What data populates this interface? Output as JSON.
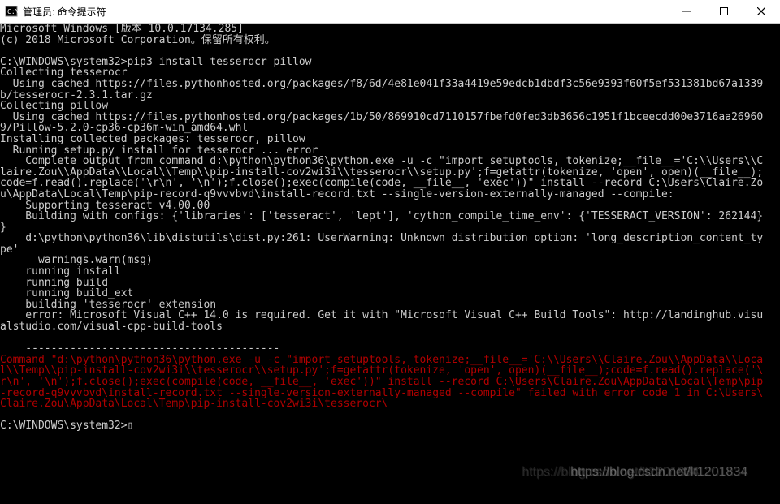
{
  "window": {
    "title": "管理员: 命令提示符",
    "icon": "cmd-icon"
  },
  "terminal": {
    "lines": [
      {
        "t": "Microsoft Windows [版本 10.0.17134.285]",
        "c": ""
      },
      {
        "t": "(c) 2018 Microsoft Corporation。保留所有权利。",
        "c": ""
      },
      {
        "t": "",
        "c": ""
      },
      {
        "t": "C:\\WINDOWS\\system32>pip3 install tesserocr pillow",
        "c": ""
      },
      {
        "t": "Collecting tesserocr",
        "c": ""
      },
      {
        "t": "  Using cached https://files.pythonhosted.org/packages/f8/6d/4e81e041f33a4419e59edcb1dbdf3c56e9393f60f5ef531381bd67a1339",
        "c": ""
      },
      {
        "t": "b/tesserocr-2.3.1.tar.gz",
        "c": ""
      },
      {
        "t": "Collecting pillow",
        "c": ""
      },
      {
        "t": "  Using cached https://files.pythonhosted.org/packages/1b/50/869910cd7110157fbefd0fed3db3656c1951f1bceecdd00e3716aa26960",
        "c": ""
      },
      {
        "t": "9/Pillow-5.2.0-cp36-cp36m-win_amd64.whl",
        "c": ""
      },
      {
        "t": "Installing collected packages: tesserocr, pillow",
        "c": ""
      },
      {
        "t": "  Running setup.py install for tesserocr ... error",
        "c": ""
      },
      {
        "t": "    Complete output from command d:\\python\\python36\\python.exe -u -c \"import setuptools, tokenize;__file__='C:\\\\Users\\\\C",
        "c": ""
      },
      {
        "t": "laire.Zou\\\\AppData\\\\Local\\\\Temp\\\\pip-install-cov2wi3i\\\\tesserocr\\\\setup.py';f=getattr(tokenize, 'open', open)(__file__);",
        "c": ""
      },
      {
        "t": "code=f.read().replace('\\r\\n', '\\n');f.close();exec(compile(code, __file__, 'exec'))\" install --record C:\\Users\\Claire.Zo",
        "c": ""
      },
      {
        "t": "u\\AppData\\Local\\Temp\\pip-record-q9vvvbvd\\install-record.txt --single-version-externally-managed --compile:",
        "c": ""
      },
      {
        "t": "    Supporting tesseract v4.00.00",
        "c": ""
      },
      {
        "t": "    Building with configs: {'libraries': ['tesseract', 'lept'], 'cython_compile_time_env': {'TESSERACT_VERSION': 262144}",
        "c": ""
      },
      {
        "t": "}",
        "c": ""
      },
      {
        "t": "    d:\\python\\python36\\lib\\distutils\\dist.py:261: UserWarning: Unknown distribution option: 'long_description_content_ty",
        "c": ""
      },
      {
        "t": "pe'",
        "c": ""
      },
      {
        "t": "      warnings.warn(msg)",
        "c": ""
      },
      {
        "t": "    running install",
        "c": ""
      },
      {
        "t": "    running build",
        "c": ""
      },
      {
        "t": "    running build_ext",
        "c": ""
      },
      {
        "t": "    building 'tesserocr' extension",
        "c": ""
      },
      {
        "t": "    error: Microsoft Visual C++ 14.0 is required. Get it with \"Microsoft Visual C++ Build Tools\": http://landinghub.visu",
        "c": ""
      },
      {
        "t": "alstudio.com/visual-cpp-build-tools",
        "c": ""
      },
      {
        "t": "",
        "c": ""
      },
      {
        "t": "    ----------------------------------------",
        "c": ""
      },
      {
        "t": "Command \"d:\\python\\python36\\python.exe -u -c \"import setuptools, tokenize;__file__='C:\\\\Users\\\\Claire.Zou\\\\AppData\\\\Loca",
        "c": "red"
      },
      {
        "t": "l\\\\Temp\\\\pip-install-cov2wi3i\\\\tesserocr\\\\setup.py';f=getattr(tokenize, 'open', open)(__file__);code=f.read().replace('\\",
        "c": "red"
      },
      {
        "t": "r\\n', '\\n');f.close();exec(compile(code, __file__, 'exec'))\" install --record C:\\Users\\Claire.Zou\\AppData\\Local\\Temp\\pip",
        "c": "red"
      },
      {
        "t": "-record-q9vvvbvd\\install-record.txt --single-version-externally-managed --compile\" failed with error code 1 in C:\\Users\\",
        "c": "red"
      },
      {
        "t": "Claire.Zou\\AppData\\Local\\Temp\\pip-install-cov2wi3i\\tesserocr\\",
        "c": "red"
      },
      {
        "t": "",
        "c": ""
      },
      {
        "t": "C:\\WINDOWS\\system32>▯",
        "c": ""
      }
    ]
  },
  "watermark": {
    "text": "https://blog.csdn.net/lt1201834"
  }
}
